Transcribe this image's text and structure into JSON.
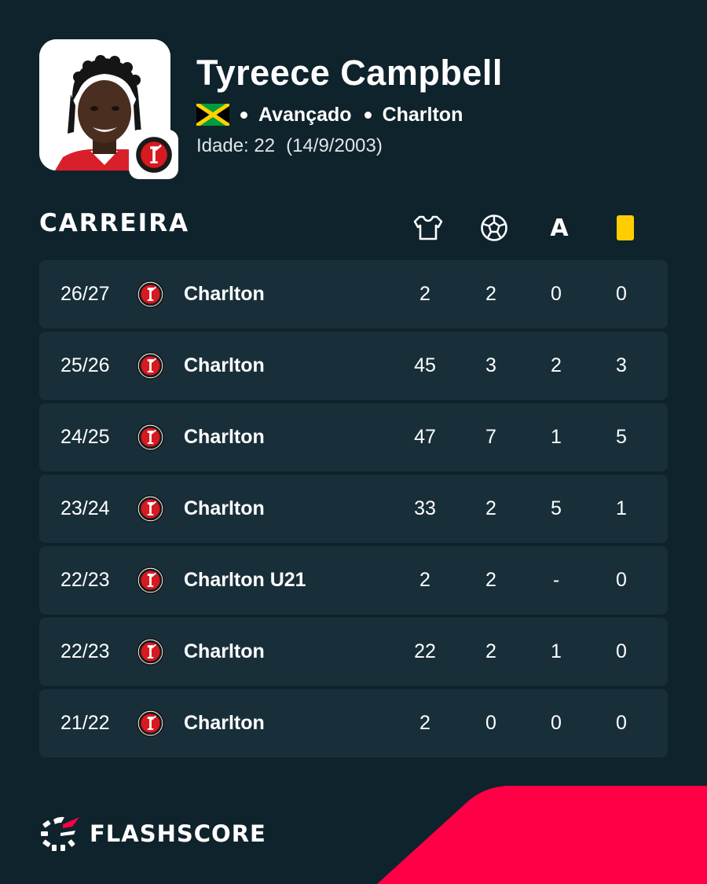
{
  "player": {
    "name": "Tyreece Campbell",
    "nationality_flag": "jamaica-flag",
    "position": "Avançado",
    "club": "Charlton",
    "age_label": "Idade: 22",
    "birth_date": "(14/9/2003)"
  },
  "career": {
    "title": "CARREIRA",
    "columns": {
      "appearances_icon": "jersey-icon",
      "goals_icon": "football-icon",
      "assists_label": "A",
      "yellow_cards_icon": "yellow-card-icon"
    },
    "rows": [
      {
        "season": "26/27",
        "team": "Charlton",
        "apps": "2",
        "goals": "2",
        "assists": "0",
        "yellow": "0"
      },
      {
        "season": "25/26",
        "team": "Charlton",
        "apps": "45",
        "goals": "3",
        "assists": "2",
        "yellow": "3"
      },
      {
        "season": "24/25",
        "team": "Charlton",
        "apps": "47",
        "goals": "7",
        "assists": "1",
        "yellow": "5"
      },
      {
        "season": "23/24",
        "team": "Charlton",
        "apps": "33",
        "goals": "2",
        "assists": "5",
        "yellow": "1"
      },
      {
        "season": "22/23",
        "team": "Charlton U21",
        "apps": "2",
        "goals": "2",
        "assists": "-",
        "yellow": "0"
      },
      {
        "season": "22/23",
        "team": "Charlton",
        "apps": "22",
        "goals": "2",
        "assists": "1",
        "yellow": "0"
      },
      {
        "season": "21/22",
        "team": "Charlton",
        "apps": "2",
        "goals": "0",
        "assists": "0",
        "yellow": "0"
      }
    ]
  },
  "brand": {
    "name": "FLASHSCORE",
    "logo_icon": "flashscore-logo-icon"
  },
  "colors": {
    "background": "#0f232c",
    "row_background": "#182f3a",
    "accent_red": "#ff0046",
    "yellow_card": "#ffcd00",
    "club_red": "#d71920"
  }
}
